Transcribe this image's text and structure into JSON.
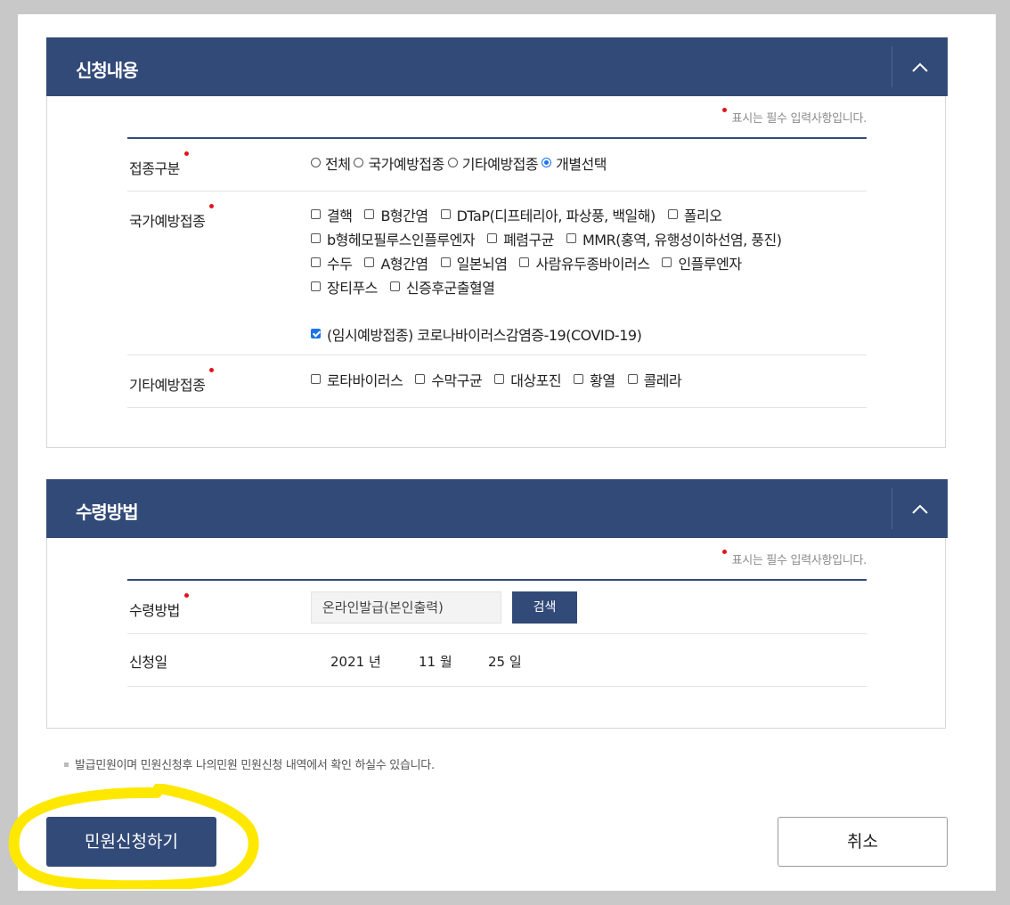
{
  "application_section": {
    "title": "신청내용",
    "required_note": "표시는 필수 입력사항입니다.",
    "vaccination_type": {
      "label": "접종구분",
      "options": [
        "전체",
        "국가예방접종",
        "기타예방접종",
        "개별선택"
      ],
      "selected": "개별선택"
    },
    "national_vaccination": {
      "label": "국가예방접종",
      "options": [
        {
          "text": "결핵",
          "checked": false
        },
        {
          "text": "B형간염",
          "checked": false
        },
        {
          "text": "DTaP(디프테리아, 파상풍, 백일해)",
          "checked": false
        },
        {
          "text": "폴리오",
          "checked": false
        },
        {
          "text": "b형헤모필루스인플루엔자",
          "checked": false
        },
        {
          "text": "폐렴구균",
          "checked": false
        },
        {
          "text": "MMR(홍역, 유행성이하선염, 풍진)",
          "checked": false
        },
        {
          "text": "수두",
          "checked": false
        },
        {
          "text": "A형간염",
          "checked": false
        },
        {
          "text": "일본뇌염",
          "checked": false
        },
        {
          "text": "사람유두종바이러스",
          "checked": false
        },
        {
          "text": "인플루엔자",
          "checked": false
        },
        {
          "text": "장티푸스",
          "checked": false
        },
        {
          "text": "신증후군출혈열",
          "checked": false
        },
        {
          "text": "(임시예방접종) 코로나바이러스감염증-19(COVID-19)",
          "checked": true
        }
      ]
    },
    "other_vaccination": {
      "label": "기타예방접종",
      "options": [
        {
          "text": "로타바이러스",
          "checked": false
        },
        {
          "text": "수막구균",
          "checked": false
        },
        {
          "text": "대상포진",
          "checked": false
        },
        {
          "text": "황열",
          "checked": false
        },
        {
          "text": "콜레라",
          "checked": false
        }
      ]
    }
  },
  "receipt_section": {
    "title": "수령방법",
    "required_note": "표시는 필수 입력사항입니다.",
    "method_label": "수령방법",
    "method_value": "온라인발급(본인출력)",
    "search_label": "검색",
    "date_label": "신청일",
    "date": {
      "year": "2021 년",
      "month": "11 월",
      "day": "25 일"
    }
  },
  "notice": "발급민원이며 민원신청후 나의민원 민원신청 내역에서 확인 하실수 있습니다.",
  "submit_label": "민원신청하기",
  "cancel_label": "취소",
  "colors": {
    "header": "#324a78",
    "required": "#e0151d",
    "highlight": "#ffe800"
  }
}
